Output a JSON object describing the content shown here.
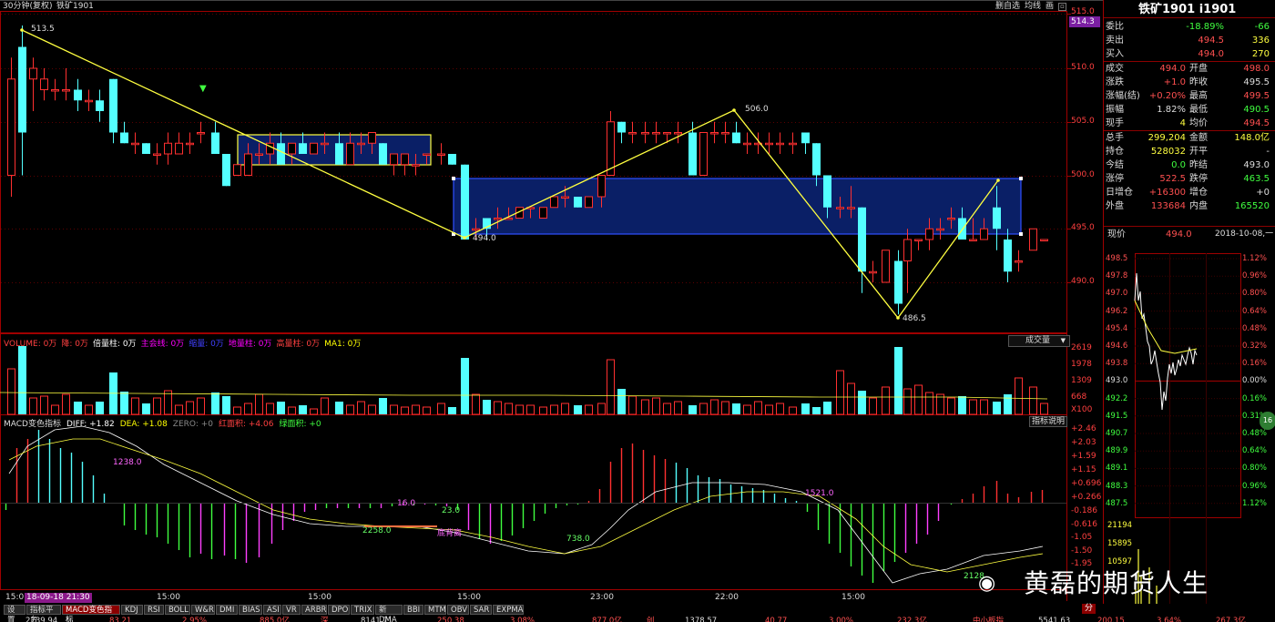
{
  "window": {
    "title": "30分钟(复权)",
    "symbol_label": "铁矿1901"
  },
  "top_buttons": [
    "删自选",
    "均线",
    "画"
  ],
  "price_axis": [
    "515.0",
    "510.0",
    "505.0",
    "500.0",
    "495.0",
    "490.0"
  ],
  "current_price_tag": "514.3",
  "candle_annotations": [
    "513.5",
    "494.0",
    "506.0",
    "486.5"
  ],
  "volume_panel": {
    "legend": [
      {
        "text": "VOLUME: 0万",
        "color": "#ff4040"
      },
      {
        "text": "降: 0万",
        "color": "#ff4040"
      },
      {
        "text": "倍量柱: 0万",
        "color": "#ffffff"
      },
      {
        "text": "主会线: 0万",
        "color": "#ff00ff"
      },
      {
        "text": "缩量: 0万",
        "color": "#4040ff"
      },
      {
        "text": "地量柱: 0万",
        "color": "#ff00ff"
      },
      {
        "text": "高量柱: 0万",
        "color": "#ff4040"
      },
      {
        "text": "MA1: 0万",
        "color": "#ffff00"
      }
    ],
    "dropdown": "成交量",
    "axis": [
      "2619",
      "1978",
      "1309",
      "668",
      "X100"
    ]
  },
  "macd_panel": {
    "legend": [
      {
        "text": "MACD变色指标",
        "color": "#dddddd"
      },
      {
        "text": "DIFF: +1.82",
        "color": "#ffffff"
      },
      {
        "text": "DEA: +1.08",
        "color": "#ffff00"
      },
      {
        "text": "ZERO: +0",
        "color": "#888888"
      },
      {
        "text": "红面积: +4.06",
        "color": "#ff4040"
      },
      {
        "text": "绿面积: +0",
        "color": "#40ff40"
      }
    ],
    "help_button": "指标说明",
    "axis": [
      "+2.46",
      "+2.03",
      "+1.59",
      "+1.15",
      "+0.696",
      "+0.266",
      "-0.186",
      "-0.616",
      "-1.05",
      "-1.50",
      "-1.95"
    ],
    "annotations": [
      {
        "text": "1238.0",
        "color": "#ff66ff"
      },
      {
        "text": "2258.0",
        "color": "#66ff66"
      },
      {
        "text": "16.0",
        "color": "#ff66ff"
      },
      {
        "text": "23.0",
        "color": "#66ff66"
      },
      {
        "text": "底背离",
        "color": "#ff66ff"
      },
      {
        "text": "738.0",
        "color": "#66ff66"
      },
      {
        "text": "1521.0",
        "color": "#ff66ff"
      },
      {
        "text": "2128",
        "color": "#66ff66"
      }
    ]
  },
  "time_axis": {
    "date_tag": "18-09-18 21:30",
    "labels": [
      "15:00",
      "15:00",
      "23:00",
      "22:00",
      "15:00"
    ]
  },
  "tabs": [
    "设置",
    "指标平台",
    "MACD变色指标",
    "KDJ",
    "RSI",
    "BOLL",
    "W&R",
    "DMI",
    "BIAS",
    "ASI",
    "VR",
    "ARBR",
    "DPO",
    "TRIX",
    "新DMA",
    "BBI",
    "MTM",
    "OBV",
    "SAR",
    "EXPMA"
  ],
  "status_strip": [
    "2739.94",
    "83.21",
    "2.95%",
    "885.0亿",
    "深",
    "8141.71",
    "250.38",
    "3.08%",
    "877.0亿",
    "创",
    "1378.57",
    "40.77",
    "3.00%",
    "232.3亿",
    "中小板指",
    "5541.63",
    "200.15",
    "3.64%",
    "267.3亿"
  ],
  "quote": {
    "title": "铁矿1901 i1901",
    "rows": [
      {
        "label": "委比",
        "v1": "-18.89%",
        "c1": "#40ff40",
        "v2": "-66",
        "c2": "#40ff40"
      },
      {
        "label": "卖出",
        "v1": "494.5",
        "c1": "#ff5050",
        "v2": "336",
        "c2": "#ffff40"
      },
      {
        "label": "买入",
        "v1": "494.0",
        "c1": "#ff5050",
        "v2": "270",
        "c2": "#ffff40"
      },
      {
        "label": "成交",
        "v1": "494.0",
        "c1": "#ff5050",
        "l2": "开盘",
        "v2": "498.0",
        "c2": "#ff5050"
      },
      {
        "label": "涨跌",
        "v1": "+1.0",
        "c1": "#ff5050",
        "l2": "昨收",
        "v2": "495.5",
        "c2": "#dddddd"
      },
      {
        "label": "涨幅(结)",
        "v1": "+0.20%",
        "c1": "#ff5050",
        "l2": "最高",
        "v2": "499.5",
        "c2": "#ff5050"
      },
      {
        "label": "振幅",
        "v1": "1.82%",
        "c1": "#dddddd",
        "l2": "最低",
        "v2": "490.5",
        "c2": "#40ff40"
      },
      {
        "label": "现手",
        "v1": "4",
        "c1": "#ffff40",
        "l2": "均价",
        "v2": "494.5",
        "c2": "#ff5050"
      },
      {
        "label": "总手",
        "v1": "299,204",
        "c1": "#ffff40",
        "l2": "金额",
        "v2": "148.0亿",
        "c2": "#ffff40"
      },
      {
        "label": "持仓",
        "v1": "528032",
        "c1": "#ffff40",
        "l2": "开平",
        "v2": "-",
        "c2": "#dddddd"
      },
      {
        "label": "今结",
        "v1": "0.0",
        "c1": "#40ff40",
        "l2": "昨结",
        "v2": "493.0",
        "c2": "#dddddd"
      },
      {
        "label": "涨停",
        "v1": "522.5",
        "c1": "#ff5050",
        "l2": "跌停",
        "v2": "463.5",
        "c2": "#40ff40"
      },
      {
        "label": "日增仓",
        "v1": "+16300",
        "c1": "#ff5050",
        "l2": "增仓",
        "v2": "+0",
        "c2": "#dddddd"
      },
      {
        "label": "外盘",
        "v1": "133684",
        "c1": "#ff5050",
        "l2": "内盘",
        "v2": "165520",
        "c2": "#40ff40"
      }
    ],
    "current_label": "现价",
    "current_value": "494.0",
    "current_date": "2018-10-08,一"
  },
  "mini_chart": {
    "left_axis": [
      "498.5",
      "497.8",
      "497.0",
      "496.2",
      "495.4",
      "494.6",
      "493.8",
      "493.0",
      "492.2",
      "491.5",
      "490.7",
      "489.9",
      "489.1",
      "488.3",
      "487.5"
    ],
    "right_axis": [
      "1.12%",
      "0.96%",
      "0.80%",
      "0.64%",
      "0.48%",
      "0.32%",
      "0.16%",
      "0.00%",
      "0.16%",
      "0.31%",
      "0.48%",
      "0.64%",
      "0.80%",
      "0.96%",
      "1.12%"
    ],
    "vol_axis": [
      "21194",
      "15895",
      "10597"
    ],
    "badge": "16"
  },
  "watermark": "黄磊的期货人生"
}
